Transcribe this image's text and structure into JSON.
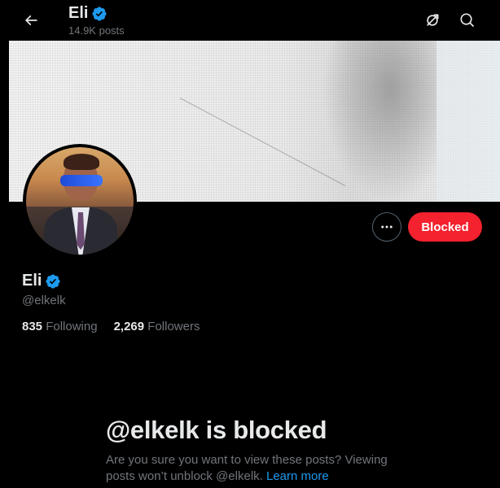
{
  "header": {
    "title": "Eli",
    "posts_count": "14.9K posts",
    "icons": [
      "back-arrow-icon",
      "verified-badge-icon",
      "grok-icon",
      "search-icon"
    ]
  },
  "profile": {
    "name": "Eli",
    "handle": "@elkelk",
    "following_count": "835",
    "following_label": "Following",
    "followers_count": "2,269",
    "followers_label": "Followers",
    "blocked_button_label": "Blocked",
    "more_icon": "more-dots-icon"
  },
  "blocked_notice": {
    "title": "@elkelk is blocked",
    "description": "Are you sure you want to view these posts? Viewing posts won’t unblock @elkelk.",
    "learn_more": "Learn more"
  },
  "colors": {
    "background": "#000000",
    "blocked_red": "#f4212e",
    "verified_blue": "#1d9bf0",
    "secondary_text": "#71767b"
  }
}
